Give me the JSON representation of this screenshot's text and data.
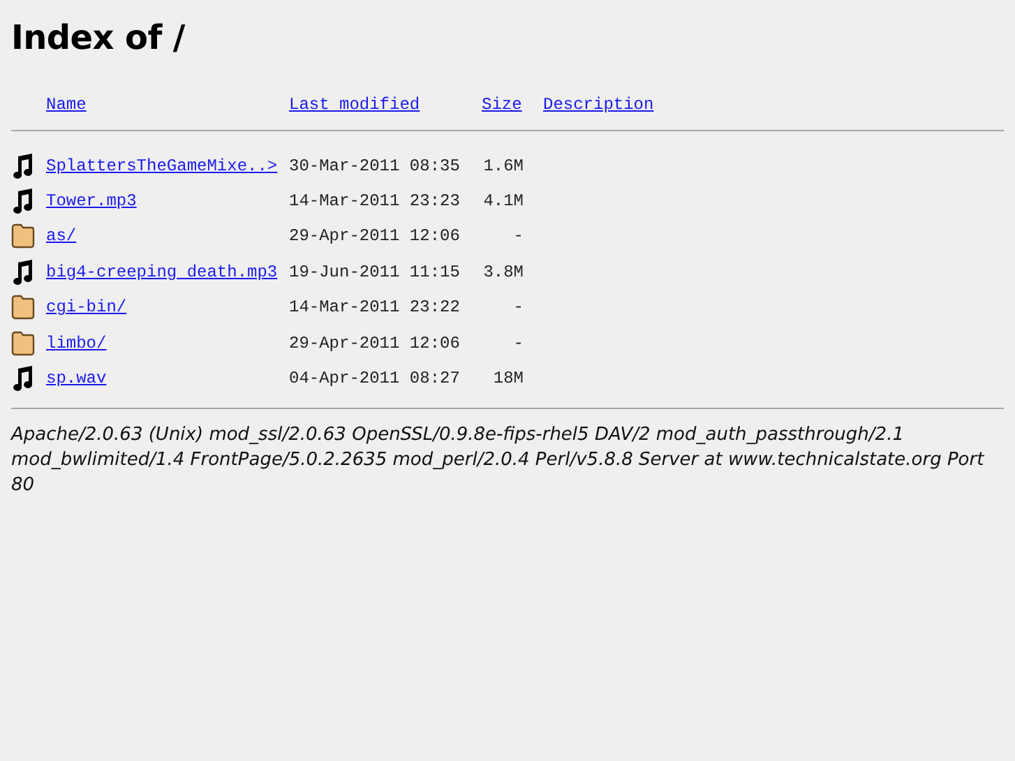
{
  "title": "Index of /",
  "columns": [
    "Name",
    "Last modified",
    "Size",
    "Description"
  ],
  "rows": [
    {
      "kind": "audio",
      "name": "SplattersTheGameMixe..>",
      "modified": "30-Mar-2011 08:35",
      "size": "1.6M"
    },
    {
      "kind": "audio",
      "name": "Tower.mp3",
      "modified": "14-Mar-2011 23:23",
      "size": "4.1M"
    },
    {
      "kind": "folder",
      "name": "as/",
      "modified": "29-Apr-2011 12:06",
      "size": "-"
    },
    {
      "kind": "audio",
      "name": "big4-creeping death.mp3",
      "modified": "19-Jun-2011 11:15",
      "size": "3.8M"
    },
    {
      "kind": "folder",
      "name": "cgi-bin/",
      "modified": "14-Mar-2011 23:22",
      "size": "-"
    },
    {
      "kind": "folder",
      "name": "limbo/",
      "modified": "29-Apr-2011 12:06",
      "size": "-"
    },
    {
      "kind": "audio",
      "name": "sp.wav",
      "modified": "04-Apr-2011 08:27",
      "size": "18M"
    }
  ],
  "address": "Apache/2.0.63 (Unix) mod_ssl/2.0.63 OpenSSL/0.9.8e-fips-rhel5 DAV/2 mod_auth_passthrough/2.1 mod_bwlimited/1.4 FrontPage/5.0.2.2635 mod_perl/2.0.4 Perl/v5.8.8 Server at www.technicalstate.org Port 80"
}
